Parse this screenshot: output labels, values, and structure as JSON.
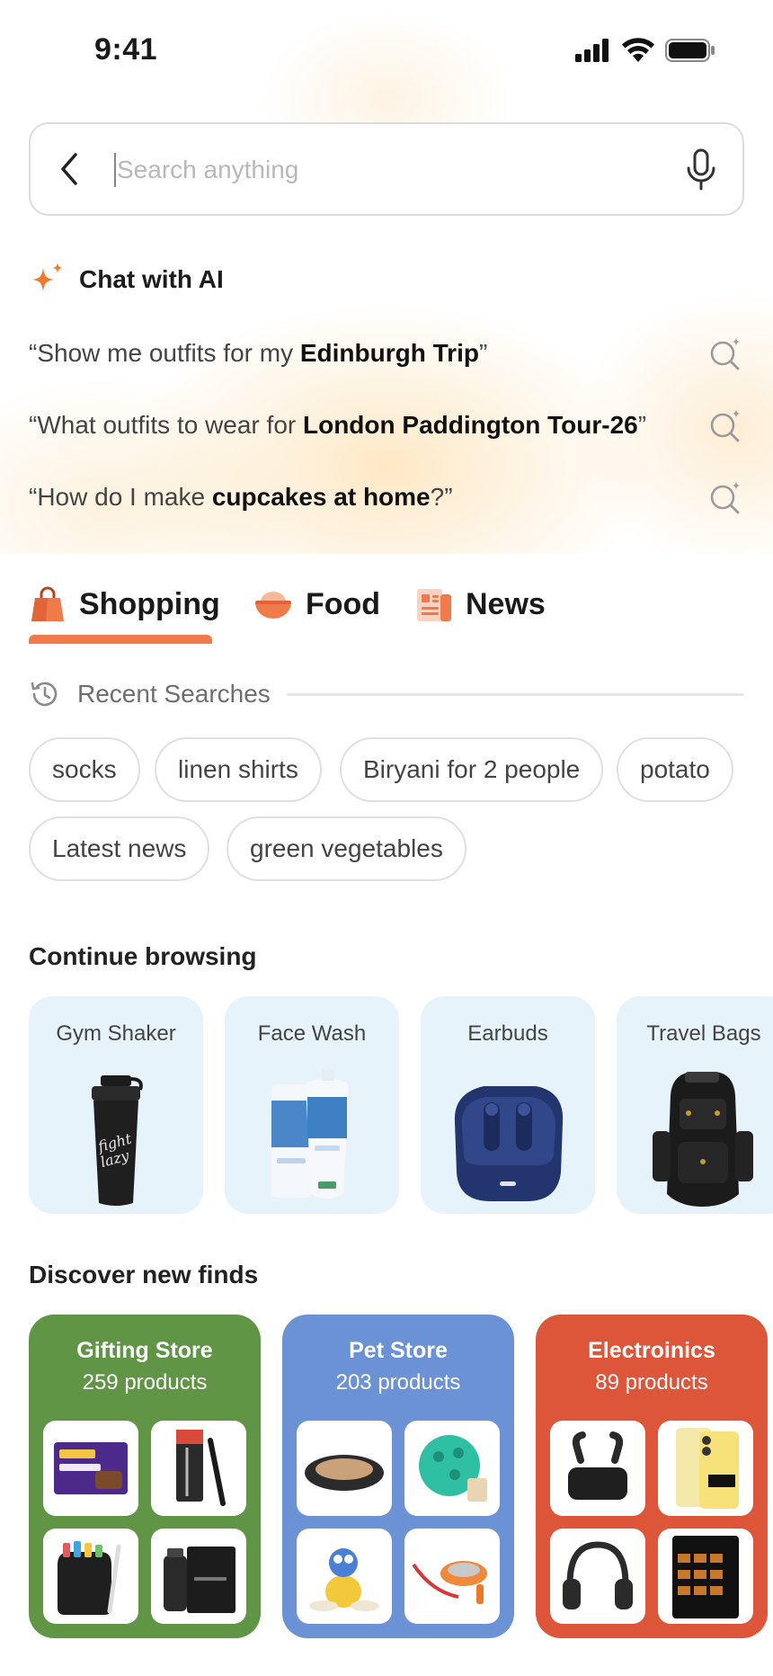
{
  "status_bar": {
    "time": "9:41"
  },
  "search": {
    "placeholder": "Search anything"
  },
  "chat_ai": {
    "title": "Chat with AI",
    "prompts": [
      {
        "prefix": "“Show me outfits for my ",
        "bold": "Edinburgh Trip",
        "suffix": "”"
      },
      {
        "prefix": "“What outfits to wear for ",
        "bold": "London Paddington Tour-26",
        "suffix": "”"
      },
      {
        "prefix": "“How do I make ",
        "bold": "cupcakes at home",
        "suffix": "?”"
      }
    ]
  },
  "tabs": [
    {
      "label": "Shopping",
      "icon": "shopping-bag-icon",
      "active": true
    },
    {
      "label": "Food",
      "icon": "food-bowl-icon",
      "active": false
    },
    {
      "label": "News",
      "icon": "newspaper-icon",
      "active": false
    }
  ],
  "recent": {
    "title": "Recent Searches",
    "chips": [
      "socks",
      "linen shirts",
      "Biryani for 2 people",
      "potato",
      "Latest news",
      "green vegetables"
    ]
  },
  "continue_browsing": {
    "title": "Continue browsing",
    "items": [
      {
        "label": "Gym Shaker"
      },
      {
        "label": "Face Wash"
      },
      {
        "label": "Earbuds"
      },
      {
        "label": "Travel Bags"
      }
    ]
  },
  "discover": {
    "title": "Discover new finds",
    "stores": [
      {
        "name": "Gifting Store",
        "count": "259 products",
        "color": "#5f9545"
      },
      {
        "name": "Pet Store",
        "count": "203 products",
        "color": "#6b92d4"
      },
      {
        "name": "Electroinics",
        "count": "89 products",
        "color": "#dd5639"
      }
    ]
  },
  "colors": {
    "accent": "#f07a4a",
    "browse_card_bg": "#e6f3fb"
  }
}
